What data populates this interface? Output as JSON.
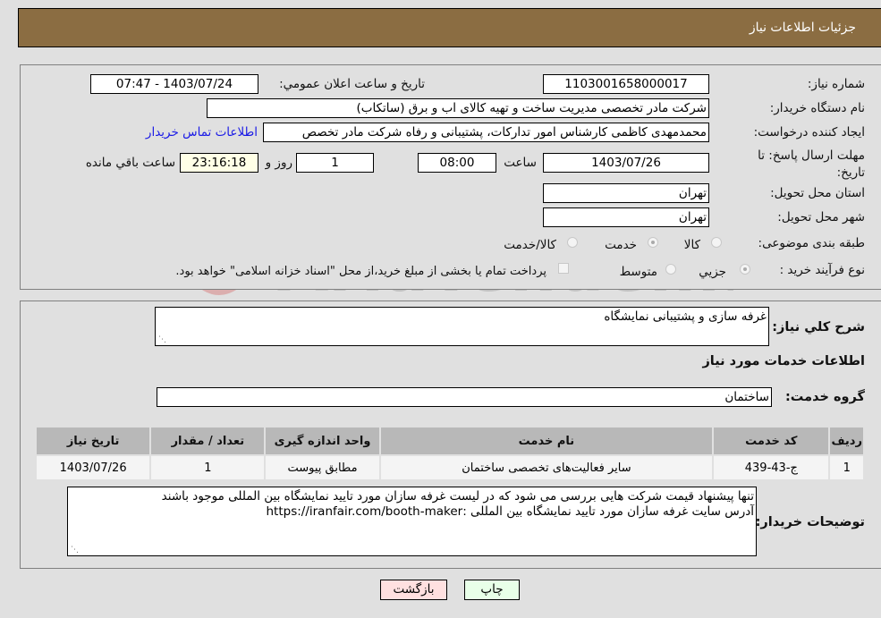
{
  "header": {
    "title": "جزئیات اطلاعات نیاز"
  },
  "form": {
    "need_number": {
      "label": "شماره نیاز:",
      "value": "1103001658000017"
    },
    "announce_datetime": {
      "label": "تاریخ و ساعت اعلان عمومي:",
      "value": "1403/07/24 - 07:47"
    },
    "buyer_org": {
      "label": "نام دستگاه خريدار:",
      "value": "شرکت مادر تخصصی مدیریت ساخت و تهیه کالای اب و برق (ساتکاب)"
    },
    "requester": {
      "label": "ايجاد کننده درخواست:",
      "value": "محمدمهدی کاظمی کارشناس امور تدارکات، پشتیبانی و رفاه شرکت مادر تخصص"
    },
    "buyer_contact_link": "اطلاعات تماس خريدار",
    "deadline": {
      "label": "مهلت ارسال پاسخ: تا تاریخ:",
      "date": "1403/07/26",
      "time_label": "ساعت",
      "time": "08:00",
      "days": "1",
      "days_label": "روز و",
      "remaining": "23:16:18",
      "remaining_label": "ساعت باقي مانده"
    },
    "province": {
      "label": "استان محل تحويل:",
      "value": "تهران"
    },
    "city": {
      "label": "شهر محل تحويل:",
      "value": "تهران"
    },
    "category": {
      "label": "طبقه بندی موضوعی:",
      "options": [
        "کالا",
        "خدمت",
        "کالا/خدمت"
      ],
      "selected": "خدمت"
    },
    "purchase_process": {
      "label": "نوع فرآيند خريد :",
      "options": [
        "جزيي",
        "متوسط"
      ],
      "selected": "جزيي",
      "treasury_note": "پرداخت تمام يا بخشی از مبلغ خريد،از محل \"اسناد خزانه اسلامی\" خواهد بود."
    }
  },
  "description": {
    "label": "شرح کلي نياز:",
    "value": "غرفه سازی و پشتیبانی نمایشگاه"
  },
  "services": {
    "section_title": "اطلاعات خدمات مورد نياز",
    "group_label": "گروه خدمت:",
    "group_value": "ساختمان",
    "columns": [
      "رديف",
      "کد خدمت",
      "نام خدمت",
      "واحد اندازه گيری",
      "تعداد / مقدار",
      "تاريخ نياز"
    ],
    "rows": [
      [
        "1",
        "ج-43-439",
        "سایر فعالیت‌های تخصصی ساختمان",
        "مطابق پیوست",
        "1",
        "1403/07/26"
      ]
    ]
  },
  "buyer_notes": {
    "label": "توضيحات خريدار:",
    "line1": "تنها پیشنهاد قیمت شرکت هایی بررسی می شود که در لیست غرفه سازان مورد تایید نمایشگاه بین المللی موجود باشند",
    "line2": "آدرس سایت غرفه سازان مورد تایید نمایشگاه بین المللی :https://iranfair.com/booth-maker"
  },
  "buttons": {
    "print": "چاپ",
    "back": "بازگشت"
  },
  "colors": {
    "header_bg": "#8b6d42",
    "link": "#1a1ae6",
    "back_bg": "#ffe0e0",
    "print_bg": "#e8ffe8"
  }
}
